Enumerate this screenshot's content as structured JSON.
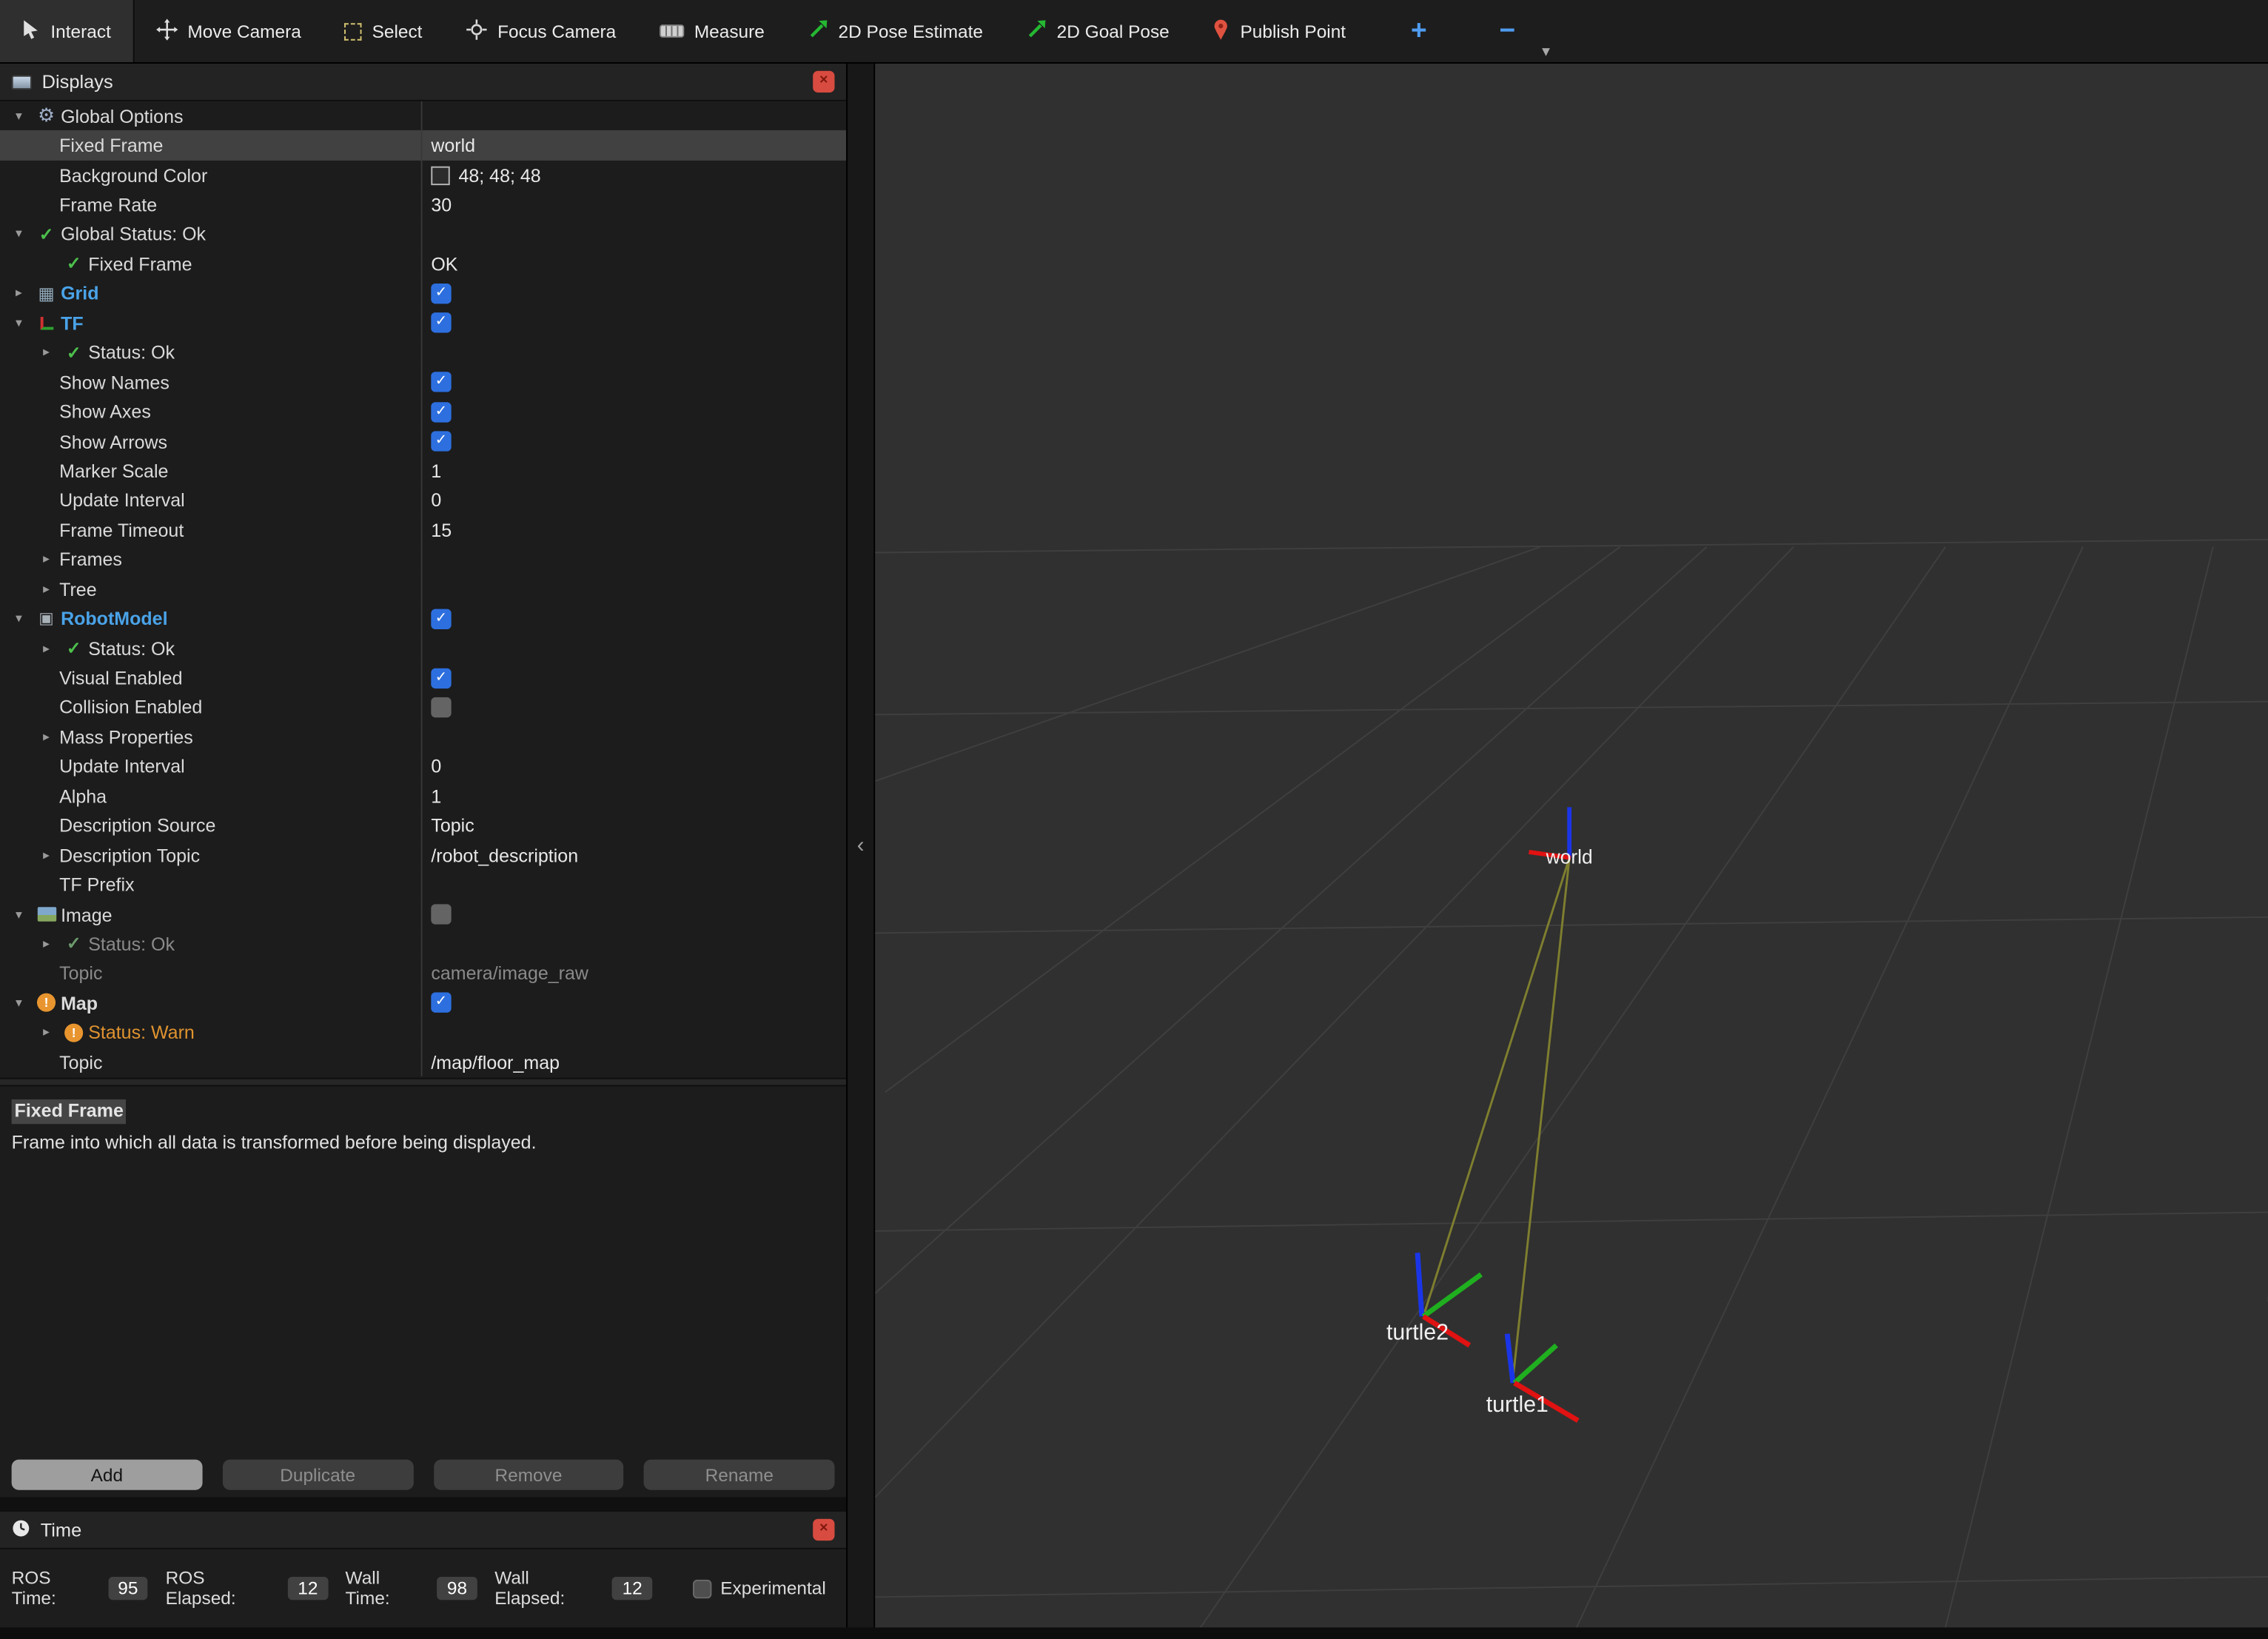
{
  "toolbar": {
    "tools": [
      {
        "label": "Interact"
      },
      {
        "label": "Move Camera"
      },
      {
        "label": "Select"
      },
      {
        "label": "Focus Camera"
      },
      {
        "label": "Measure"
      },
      {
        "label": "2D Pose Estimate"
      },
      {
        "label": "2D Goal Pose"
      },
      {
        "label": "Publish Point"
      }
    ],
    "plus_label": "+",
    "minus_label": "−",
    "overflow_chevron": "▾"
  },
  "displays": {
    "title": "Displays",
    "close_glyph": "×",
    "rows": [
      {
        "level": 0,
        "exp": "open",
        "icon": "gear",
        "name": "Global Options"
      },
      {
        "level": 1,
        "name": "Fixed Frame",
        "value": "world",
        "selected": true
      },
      {
        "level": 1,
        "name": "Background Color",
        "value": "48; 48; 48",
        "vtype": "color"
      },
      {
        "level": 1,
        "name": "Frame Rate",
        "value": "30"
      },
      {
        "level": 0,
        "exp": "open",
        "icon": "check",
        "name": "Global Status: Ok"
      },
      {
        "level": 1,
        "icon": "check",
        "name": "Fixed Frame",
        "value": "OK"
      },
      {
        "level": 0,
        "exp": "closed",
        "icon": "grid",
        "name": "Grid",
        "cls": "display",
        "vtype": "check-on"
      },
      {
        "level": 0,
        "exp": "open",
        "icon": "tf",
        "name": "TF",
        "cls": "display",
        "vtype": "check-on"
      },
      {
        "level": 1,
        "exp": "closed",
        "icon": "check",
        "name": "Status: Ok"
      },
      {
        "level": 1,
        "name": "Show Names",
        "vtype": "check-on"
      },
      {
        "level": 1,
        "name": "Show Axes",
        "vtype": "check-on"
      },
      {
        "level": 1,
        "name": "Show Arrows",
        "vtype": "check-on"
      },
      {
        "level": 1,
        "name": "Marker Scale",
        "value": "1"
      },
      {
        "level": 1,
        "name": "Update Interval",
        "value": "0"
      },
      {
        "level": 1,
        "name": "Frame Timeout",
        "value": "15"
      },
      {
        "level": 1,
        "exp": "closed",
        "name": "Frames"
      },
      {
        "level": 1,
        "exp": "closed",
        "name": "Tree"
      },
      {
        "level": 0,
        "exp": "open",
        "icon": "robot",
        "name": "RobotModel",
        "cls": "display",
        "vtype": "check-on"
      },
      {
        "level": 1,
        "exp": "closed",
        "icon": "check",
        "name": "Status: Ok"
      },
      {
        "level": 1,
        "name": "Visual Enabled",
        "vtype": "check-on"
      },
      {
        "level": 1,
        "name": "Collision Enabled",
        "vtype": "check-off"
      },
      {
        "level": 1,
        "exp": "closed",
        "name": "Mass Properties"
      },
      {
        "level": 1,
        "name": "Update Interval",
        "value": "0"
      },
      {
        "level": 1,
        "name": "Alpha",
        "value": "1"
      },
      {
        "level": 1,
        "name": "Description Source",
        "value": "Topic"
      },
      {
        "level": 1,
        "exp": "closed",
        "name": "Description Topic",
        "value": "/robot_description"
      },
      {
        "level": 1,
        "name": "TF Prefix"
      },
      {
        "level": 0,
        "exp": "open",
        "icon": "image",
        "name": "Image",
        "vtype": "check-off"
      },
      {
        "level": 1,
        "exp": "closed",
        "icon": "check",
        "name": "Status: Ok",
        "dim": true
      },
      {
        "level": 1,
        "name": "Topic",
        "value": "camera/image_raw",
        "dim": true
      },
      {
        "level": 0,
        "exp": "open",
        "icon": "warn",
        "name": "Map",
        "cls": "bold",
        "vtype": "check-on"
      },
      {
        "level": 1,
        "exp": "closed",
        "icon": "warn",
        "name": "Status: Warn",
        "cls": "warn"
      },
      {
        "level": 1,
        "name": "Topic",
        "value": "/map/floor_map"
      }
    ],
    "help_title": "Fixed Frame",
    "help_text": "Frame into which all data is transformed before being displayed.",
    "buttons": [
      {
        "label": "Add",
        "enabled": true
      },
      {
        "label": "Duplicate",
        "enabled": false
      },
      {
        "label": "Remove",
        "enabled": false
      },
      {
        "label": "Rename",
        "enabled": false
      }
    ]
  },
  "time": {
    "title": "Time",
    "close_glyph": "×",
    "fields": [
      {
        "label": "ROS Time:",
        "value": "95"
      },
      {
        "label": "ROS Elapsed:",
        "value": "12"
      },
      {
        "label": "Wall Time:",
        "value": "98"
      },
      {
        "label": "Wall Elapsed:",
        "value": "12"
      }
    ],
    "experimental_label": "Experimental"
  },
  "splitter": {
    "collapse_glyph": "‹"
  },
  "viewport": {
    "background": "#303030",
    "frames": [
      {
        "name": "world"
      },
      {
        "name": "turtle2"
      },
      {
        "name": "turtle1"
      }
    ]
  },
  "colors": {
    "accent_checkbox_blue": "#2d6fdf",
    "display_name_blue": "#4aa3e8",
    "warn_orange": "#e8952f",
    "status_green": "#4cc04c",
    "close_red": "#d84b40",
    "axis_x_red": "#e01212",
    "axis_y_green": "#1faf1f",
    "axis_z_blue": "#1a35e8",
    "tf_link_olive": "#7e7e2f"
  }
}
